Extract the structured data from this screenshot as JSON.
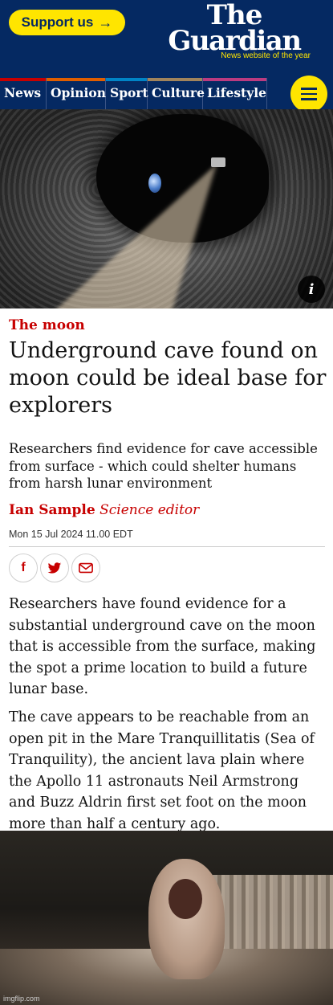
{
  "header": {
    "support_label": "Support us",
    "support_arrow": "→",
    "logo_line1": "The",
    "logo_line2": "Guardian",
    "tagline": "News website of the year"
  },
  "nav": {
    "items": [
      {
        "label": "News",
        "color": "#c70000"
      },
      {
        "label": "Opinion",
        "color": "#e05e00"
      },
      {
        "label": "Sport",
        "color": "#0084c6"
      },
      {
        "label": "Culture",
        "color": "#a1845c"
      },
      {
        "label": "Lifestyle",
        "color": "#bb3b80"
      }
    ],
    "menu_icon": "hamburger-icon"
  },
  "hero": {
    "info_label": "i"
  },
  "article": {
    "kicker": "The moon",
    "headline": "Underground cave found on moon could be ideal base for explorers",
    "standfirst": "Researchers find evidence for cave accessible from surface - which could shelter humans from harsh lunar environment",
    "author": "Ian Sample",
    "author_role": "Science editor",
    "date": "Mon 15 Jul 2024 11.00 EDT",
    "share": {
      "facebook": "f",
      "twitter": "twitter-icon",
      "email": "email-icon"
    },
    "paragraphs": [
      "Researchers have found evidence for a substantial underground cave on the moon that is accessible from the surface, making the spot a prime location to build a future lunar base.",
      "The cave appears to be reachable from an open pit in the Mare Tranquillitatis (Sea of Tranquility), the ancient lava plain where the Apollo 11 astronauts Neil Armstrong and Buzz Aldrin first set foot on the moon more than half a century ago."
    ]
  },
  "meme": {
    "watermark": "imgflip.com"
  },
  "colors": {
    "brand_blue": "#052962",
    "support_yellow": "#ffe500",
    "news_red": "#c70000"
  }
}
